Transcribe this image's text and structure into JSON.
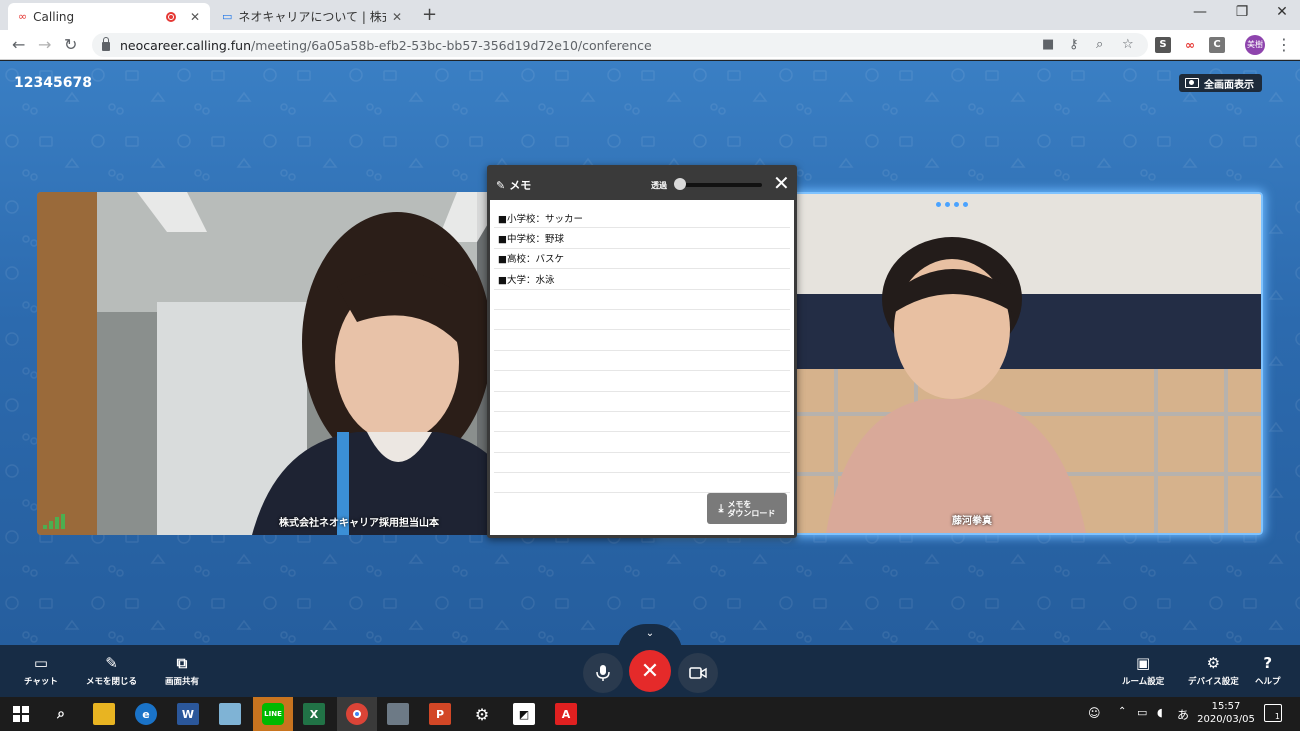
{
  "browser": {
    "tabs": [
      {
        "title": "Calling",
        "active": true
      },
      {
        "title": "ネオキャリアについて | 株式会社ネオキ",
        "active": false
      }
    ],
    "url_host": "neocareer.calling.fun",
    "url_path": "/meeting/6a05a58b-efb2-53bc-bb57-356d19d72e10/conference",
    "extensions": [
      "S",
      "C"
    ],
    "profile_label": "美樹"
  },
  "meeting": {
    "id": "12345678",
    "fullscreen_label": "全画面表示"
  },
  "videos": {
    "left_name": "株式会社ネオキャリア採用担当山本",
    "right_name": "藤河拳真"
  },
  "memo": {
    "title": "メモ",
    "opacity_label": "透過",
    "opacity_value": 0,
    "lines": [
      "■小学校：サッカー",
      "■中学校：野球",
      "■高校：バスケ",
      "■大学：水泳",
      "",
      "",
      "",
      "",
      "",
      "",
      "",
      "",
      "",
      ""
    ],
    "download_label_1": "メモを",
    "download_label_2": "ダウンロード"
  },
  "controls": {
    "chat": "チャット",
    "close_memo": "メモを閉じる",
    "screen_share": "画面共有",
    "room_settings": "ルーム設定",
    "device_settings": "デバイス設定",
    "help": "ヘルプ"
  },
  "taskbar": {
    "ime": "あ",
    "time": "15:57",
    "date": "2020/03/05",
    "notifications": "1"
  },
  "colors": {
    "app_blue": "#2c6aae",
    "hangup_red": "#e52a2a",
    "control_bar": "#172c45",
    "speaking_glow": "#7fc3ff"
  }
}
